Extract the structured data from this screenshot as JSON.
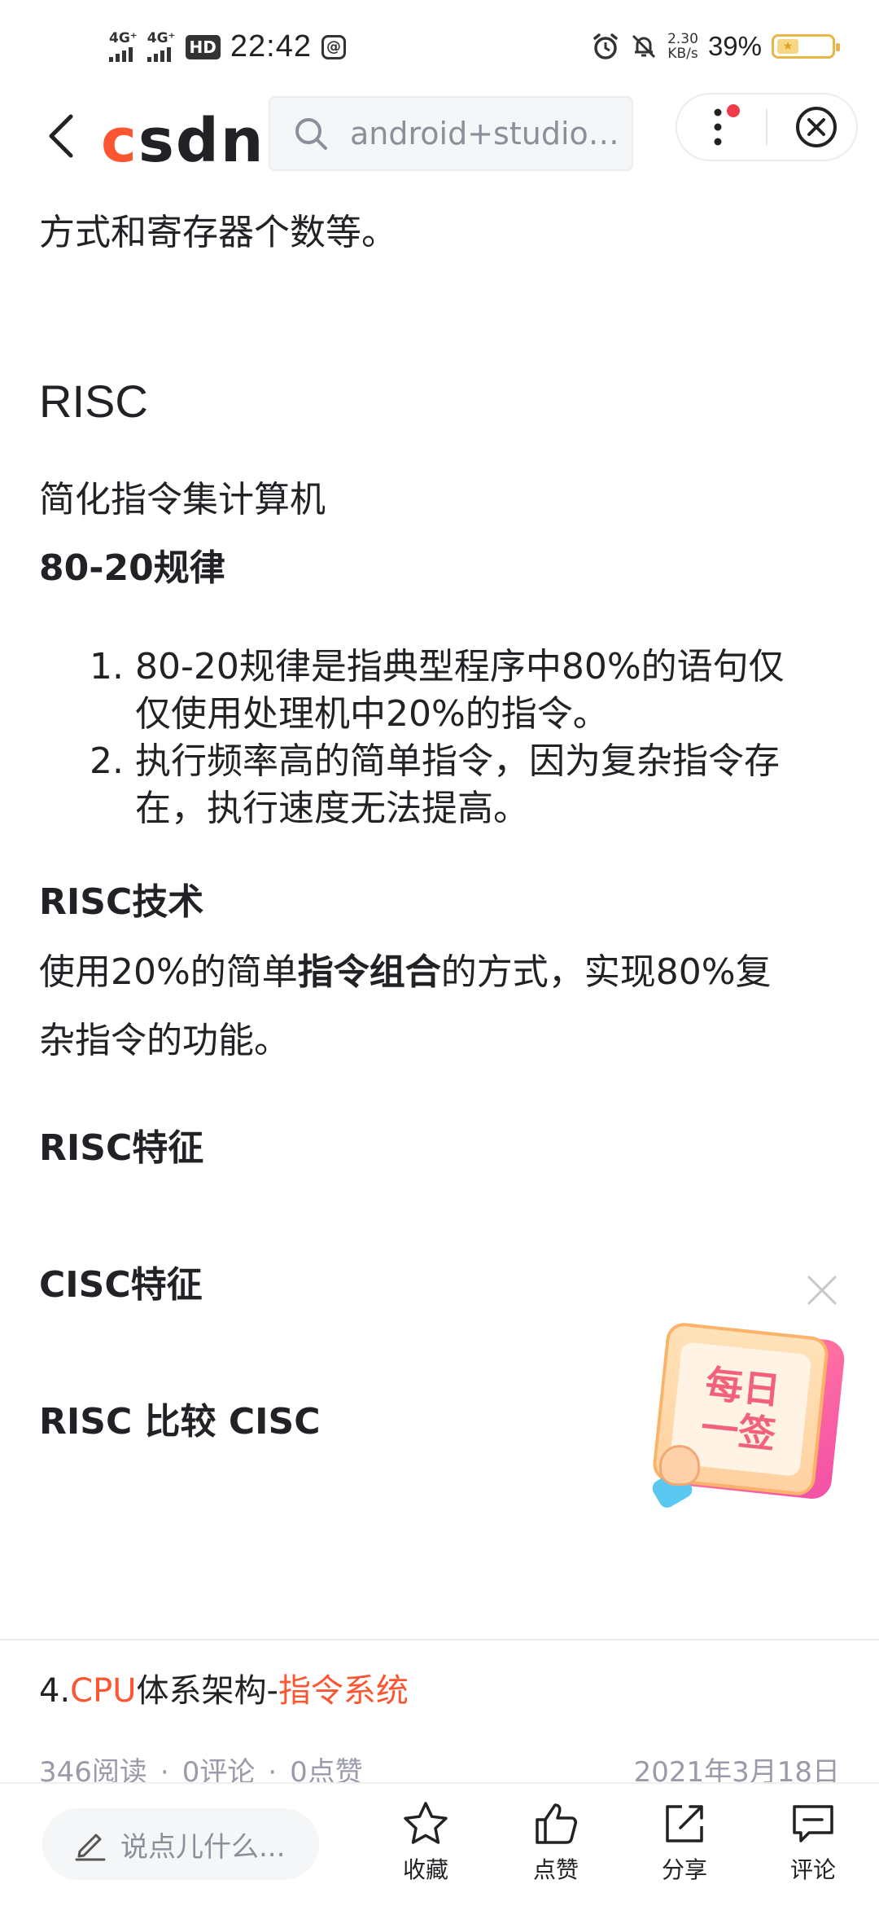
{
  "status_bar": {
    "net1": "4G⁺",
    "net2": "4G⁺",
    "hd": "HD",
    "time": "22:42",
    "speed_value": "2.30",
    "speed_unit": "KB/s",
    "battery": "39%",
    "battery_level": 0.39,
    "icons": [
      "signal-icon",
      "hd-icon",
      "at-icon",
      "alarm-icon",
      "mute-icon",
      "battery-icon"
    ]
  },
  "header": {
    "logo": "CSDN",
    "search_text": "android+studio…",
    "accent": "#fc5531",
    "notification_dot_color": "#f03c4a"
  },
  "article": {
    "intro_tail": "方式和寄存器个数等。",
    "h_risc": "RISC",
    "risc_desc": "简化指令集计算机",
    "h_8020": "80-20规律",
    "list": [
      {
        "num": "1.",
        "line1": "80-20规律是指典型程序中80%的语句仅",
        "line2": "仅使用处理机中20%的指令。"
      },
      {
        "num": "2.",
        "line1": "执行频率高的简单指令，因为复杂指令存",
        "line2": "在，执行速度无法提高。"
      }
    ],
    "h_risc_tech": "RISC技术",
    "tech_line1_a": "使用20%的简单",
    "tech_line1_b": "指令组合",
    "tech_line1_c": "的方式，实现80%复",
    "tech_line2": "杂指令的功能。",
    "h_risc_feat": "RISC特征",
    "h_cisc_feat": "CISC特征",
    "h_compare": "RISC 比较 CISC"
  },
  "daily_card": {
    "line1": "每日",
    "line2": "一签"
  },
  "related": {
    "prefix": "4.",
    "hl1": "CPU",
    "mid": "体系架构-",
    "hl2": "指令系统",
    "reads": "346阅读",
    "comments": "0评论",
    "likes": "0点赞",
    "sep": "·",
    "date": "2021年3月18日"
  },
  "bottom_bar": {
    "placeholder": "说点儿什么...",
    "collect": "收藏",
    "like": "点赞",
    "share": "分享",
    "comment": "评论"
  }
}
